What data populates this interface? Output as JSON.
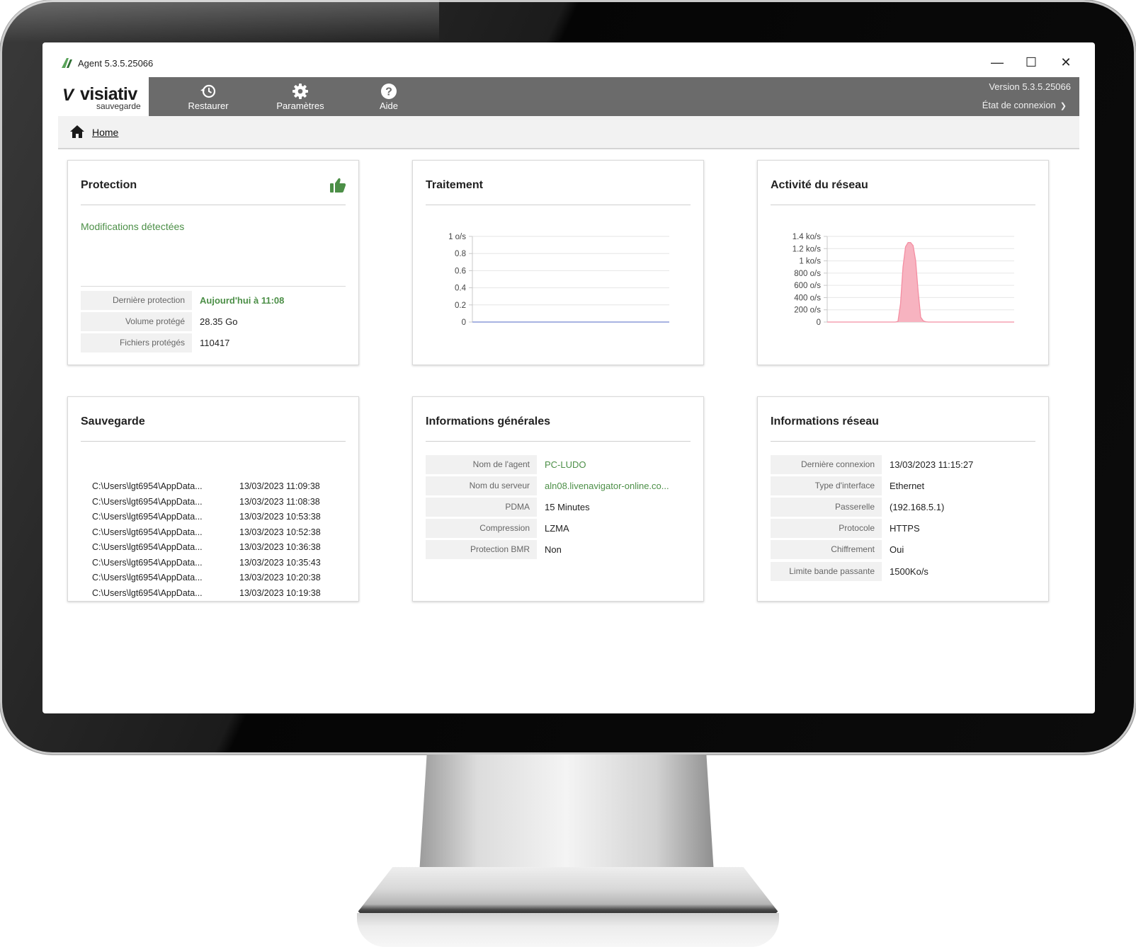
{
  "window": {
    "title": "Agent 5.3.5.25066",
    "controls": {
      "minimize": "—",
      "maximize": "☐",
      "close": "✕"
    }
  },
  "brand": {
    "mark": "V",
    "name": "visiativ",
    "subtitle": "sauvegarde"
  },
  "nav": {
    "items": [
      {
        "label": "Restaurer",
        "icon": "history-icon"
      },
      {
        "label": "Paramètres",
        "icon": "gear-icon"
      },
      {
        "label": "Aide",
        "icon": "help-icon"
      }
    ],
    "version": "Version 5.3.5.25066",
    "connection_state": "État de connexion"
  },
  "breadcrumb": {
    "home": "Home"
  },
  "colors": {
    "navbar": "#6b6b6b",
    "accent_green": "#4c8f47",
    "network_fill": "#f7b3c0",
    "network_line": "#f48ea2",
    "processing_line": "#8c9ad8"
  },
  "protection": {
    "title": "Protection",
    "status": "Modifications détectées",
    "rows": [
      {
        "key": "Dernière protection",
        "value": "Aujourd'hui à 11:08"
      },
      {
        "key": "Volume protégé",
        "value": "28.35 Go"
      },
      {
        "key": "Fichiers protégés",
        "value": "110417"
      }
    ]
  },
  "processing": {
    "title": "Traitement"
  },
  "network_activity": {
    "title": "Activité du réseau"
  },
  "chart_data": [
    {
      "type": "line",
      "chart": "Traitement",
      "yticks": [
        "1 o/s",
        "0.8",
        "0.6",
        "0.4",
        "0.2",
        "0"
      ],
      "ylim": [
        0,
        1
      ],
      "series": [
        {
          "values": [
            0,
            0,
            0,
            0,
            0,
            0,
            0,
            0,
            0,
            0,
            0,
            0
          ]
        }
      ],
      "grid": true
    },
    {
      "type": "area",
      "chart": "Activité du réseau",
      "yticks": [
        "1.4 ko/s",
        "1.2 ko/s",
        "1 ko/s",
        "800 o/s",
        "600 o/s",
        "400 o/s",
        "200 o/s",
        "0"
      ],
      "ylim": [
        0,
        1400
      ],
      "series": [
        {
          "values": [
            0,
            0,
            0,
            0,
            0,
            0,
            0,
            0,
            0,
            0,
            0,
            0,
            0,
            0,
            0,
            0,
            0,
            0,
            0,
            0,
            0,
            0,
            0,
            0,
            0,
            0,
            0,
            0,
            10,
            300,
            900,
            1230,
            1300,
            1300,
            1250,
            1000,
            500,
            80,
            20,
            5,
            0,
            0,
            0,
            0,
            0,
            0,
            0,
            0,
            0,
            0,
            0,
            0,
            0,
            0,
            0,
            0,
            0,
            0,
            0,
            0,
            0,
            0,
            0,
            0,
            0,
            0,
            0,
            0,
            0,
            0,
            0,
            0,
            0,
            0,
            0
          ]
        }
      ],
      "grid": true
    }
  ],
  "backup": {
    "title": "Sauvegarde",
    "entries": [
      {
        "path": "C:\\Users\\lgt6954\\AppData...",
        "date": "13/03/2023 11:09:38"
      },
      {
        "path": "C:\\Users\\lgt6954\\AppData...",
        "date": "13/03/2023 11:08:38"
      },
      {
        "path": "C:\\Users\\lgt6954\\AppData...",
        "date": "13/03/2023 10:53:38"
      },
      {
        "path": "C:\\Users\\lgt6954\\AppData...",
        "date": "13/03/2023 10:52:38"
      },
      {
        "path": "C:\\Users\\lgt6954\\AppData...",
        "date": "13/03/2023 10:36:38"
      },
      {
        "path": "C:\\Users\\lgt6954\\AppData...",
        "date": "13/03/2023 10:35:43"
      },
      {
        "path": "C:\\Users\\lgt6954\\AppData...",
        "date": "13/03/2023 10:20:38"
      },
      {
        "path": "C:\\Users\\lgt6954\\AppData...",
        "date": "13/03/2023 10:19:38"
      }
    ]
  },
  "general_info": {
    "title": "Informations générales",
    "rows": [
      {
        "key": "Nom de l'agent",
        "value": "PC-LUDO"
      },
      {
        "key": "Nom du serveur",
        "value": "aln08.livenavigator-online.co..."
      },
      {
        "key": "PDMA",
        "value": "15 Minutes"
      },
      {
        "key": "Compression",
        "value": "LZMA"
      },
      {
        "key": "Protection BMR",
        "value": "Non"
      }
    ]
  },
  "network_info": {
    "title": "Informations réseau",
    "rows": [
      {
        "key": "Dernière connexion",
        "value": "13/03/2023 11:15:27"
      },
      {
        "key": "Type d'interface",
        "value": "Ethernet"
      },
      {
        "key": "Passerelle",
        "value": "(192.168.5.1)"
      },
      {
        "key": "Protocole",
        "value": "HTTPS"
      },
      {
        "key": "Chiffrement",
        "value": "Oui"
      },
      {
        "key": "Limite bande passante",
        "value": "1500Ko/s"
      }
    ]
  }
}
